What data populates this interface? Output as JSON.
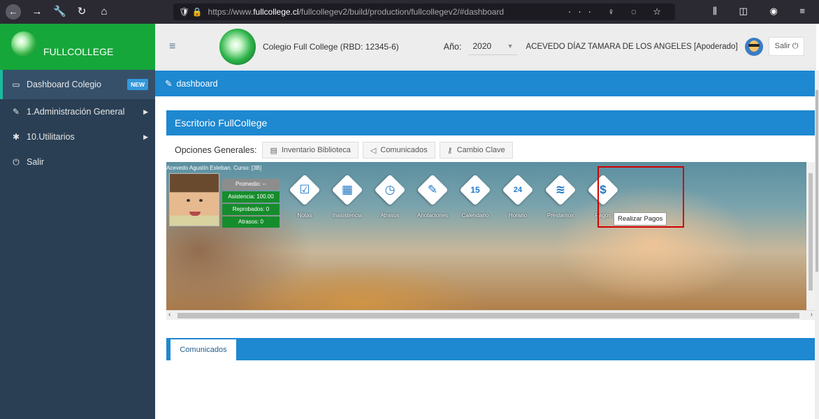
{
  "browser": {
    "url_prefix": "https://www.",
    "url_host": "fullcollege.cl",
    "url_path": "/fullcollegev2/build/production/fullcollegev2/#dashboard",
    "tools": "··· ♀ ◌ ☆",
    "right_icons": "⫼ ◫ ◉ ≡"
  },
  "sidebar": {
    "brand": "FULLCOLLEGE",
    "items": [
      {
        "label": "Dashboard Colegio",
        "badge": "NEW",
        "icon": "monitor-icon"
      },
      {
        "label": "1.Administración General",
        "icon": "edit-icon"
      },
      {
        "label": "10.Utilitarios",
        "icon": "gear-icon"
      },
      {
        "label": "Salir",
        "icon": "power-icon"
      }
    ]
  },
  "topnav": {
    "school": "Colegio Full College (RBD: 12345-6)",
    "year_label": "Año:",
    "year_value": "2020",
    "user": "ACEVEDO DÍAZ TAMARA DE LOS ANGELES [Apoderado]",
    "logout": "Salir"
  },
  "breadcrumb": {
    "label": "dashboard"
  },
  "panel": {
    "title": "Escritorio FullCollege",
    "options_label": "Opciones Generales:",
    "options": [
      {
        "label": "Inventario Biblioteca",
        "icon": "book-icon"
      },
      {
        "label": "Comunicados",
        "icon": "megaphone-icon"
      },
      {
        "label": "Cambio Clave",
        "icon": "key-icon"
      }
    ]
  },
  "student": {
    "name_line": "Acevedo Agustín Esteban. Curso: [3B]",
    "promedio": "Promedio: --",
    "asistencia": "Asistencia: 100.00",
    "reprobados": "Reprobados: 0",
    "atrasos": "Atrasos: 0"
  },
  "tiles": [
    {
      "label": "Notas",
      "icon": "checklist-icon",
      "glyph": "☑"
    },
    {
      "label": "Inasistencia",
      "icon": "calendar-grid-icon",
      "glyph": "▦"
    },
    {
      "label": "Atrasos",
      "icon": "clock-icon",
      "glyph": "◷"
    },
    {
      "label": "Anotaciones",
      "icon": "pencil-icon",
      "glyph": "✎"
    },
    {
      "label": "Calendario",
      "icon": "calendar-15-icon",
      "glyph": "15"
    },
    {
      "label": "Horario",
      "icon": "24h-icon",
      "glyph": "24"
    },
    {
      "label": "Prestamos",
      "icon": "books-stack-icon",
      "glyph": "≋"
    },
    {
      "label": "Pagos",
      "icon": "dollar-icon",
      "glyph": "$"
    }
  ],
  "tooltip": "Realizar Pagos",
  "bottom_tab": "Comunicados",
  "colors": {
    "brand_green": "#16a73a",
    "accent_blue": "#1e88d0",
    "sidebar": "#2a3f54",
    "highlight_red": "#d00000"
  }
}
